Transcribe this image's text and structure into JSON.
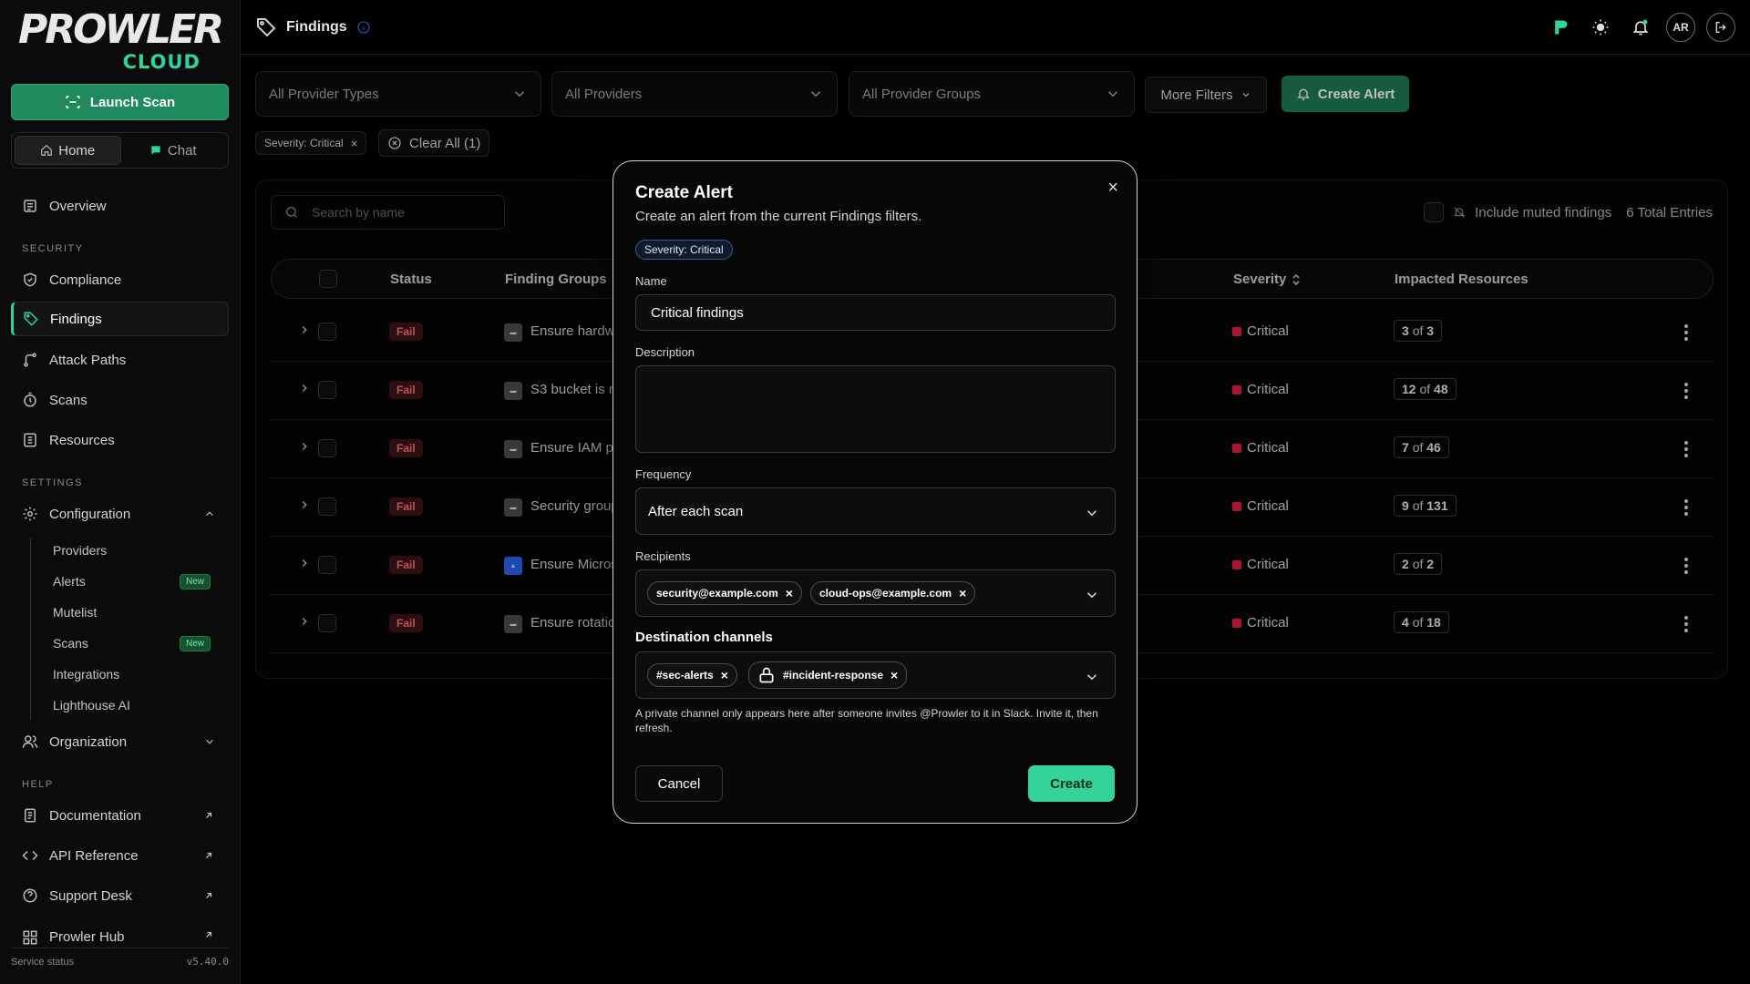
{
  "brand": {
    "name": "PROWLER",
    "sub": "CLOUD"
  },
  "sidebar": {
    "launch_label": "Launch Scan",
    "home_label": "Home",
    "chat_label": "Chat",
    "overview": "Overview",
    "security_heading": "SECURITY",
    "compliance": "Compliance",
    "findings": "Findings",
    "attack_paths": "Attack Paths",
    "scans": "Scans",
    "resources": "Resources",
    "settings_heading": "SETTINGS",
    "configuration": "Configuration",
    "sub_items": [
      {
        "label": "Providers",
        "badge": ""
      },
      {
        "label": "Alerts",
        "badge": "New"
      },
      {
        "label": "Mutelist",
        "badge": ""
      },
      {
        "label": "Scans",
        "badge": "New"
      },
      {
        "label": "Integrations",
        "badge": ""
      },
      {
        "label": "Lighthouse AI",
        "badge": ""
      }
    ],
    "organization": "Organization",
    "help_heading": "HELP",
    "documentation": "Documentation",
    "api_reference": "API Reference",
    "support_desk": "Support Desk",
    "prowler_hub": "Prowler Hub",
    "service_status": "Service status",
    "version": "v5.40.0"
  },
  "header": {
    "title": "Findings",
    "avatar": "AR"
  },
  "filters": {
    "provider_types": "All Provider Types",
    "providers": "All Providers",
    "provider_groups": "All Provider Groups",
    "more_filters": "More Filters",
    "create_alert": "Create Alert",
    "active_chip": "Severity: Critical",
    "clear_all": "Clear All (1)"
  },
  "table": {
    "search_placeholder": "Search by name",
    "include_muted": "Include muted findings",
    "total": "6 Total Entries",
    "columns": {
      "status": "Status",
      "finding_groups": "Finding Groups",
      "severity": "Severity",
      "impacted": "Impacted Resources"
    },
    "rows": [
      {
        "status": "Fail",
        "provider": "aws",
        "name": "Ensure hardw",
        "severity": "Critical",
        "imp_a": "3",
        "imp_of": "of",
        "imp_b": "3"
      },
      {
        "status": "Fail",
        "provider": "aws",
        "name": "S3 bucket is n",
        "severity": "Critical",
        "imp_a": "12",
        "imp_of": "of",
        "imp_b": "48"
      },
      {
        "status": "Fail",
        "provider": "aws",
        "name": "Ensure IAM po",
        "severity": "Critical",
        "imp_a": "7",
        "imp_of": "of",
        "imp_b": "46"
      },
      {
        "status": "Fail",
        "provider": "aws",
        "name": "Security group",
        "severity": "Critical",
        "imp_a": "9",
        "imp_of": "of",
        "imp_b": "131"
      },
      {
        "status": "Fail",
        "provider": "azure",
        "name": "Ensure Micros",
        "severity": "Critical",
        "imp_a": "2",
        "imp_of": "of",
        "imp_b": "2"
      },
      {
        "status": "Fail",
        "provider": "aws",
        "name": "Ensure rotatio",
        "severity": "Critical",
        "imp_a": "4",
        "imp_of": "of",
        "imp_b": "18"
      }
    ]
  },
  "modal": {
    "title": "Create Alert",
    "subtitle": "Create an alert from the current Findings filters.",
    "filter_chip": "Severity: Critical",
    "name_label": "Name",
    "name_value": "Critical findings",
    "description_label": "Description",
    "description_value": "",
    "frequency_label": "Frequency",
    "frequency_value": "After each scan",
    "recipients_label": "Recipients",
    "recipients": [
      "security@example.com",
      "cloud-ops@example.com"
    ],
    "channels_label": "Destination channels",
    "channels": [
      "#sec-alerts",
      "#incident-response"
    ],
    "help_text": "A private channel only appears here after someone invites @Prowler to it in Slack. Invite it, then refresh.",
    "cancel": "Cancel",
    "create": "Create"
  },
  "colors": {
    "accent": "#2dd4a4",
    "primary_button": "#34d399",
    "fail": "#f87171",
    "critical": "#e11d48"
  }
}
